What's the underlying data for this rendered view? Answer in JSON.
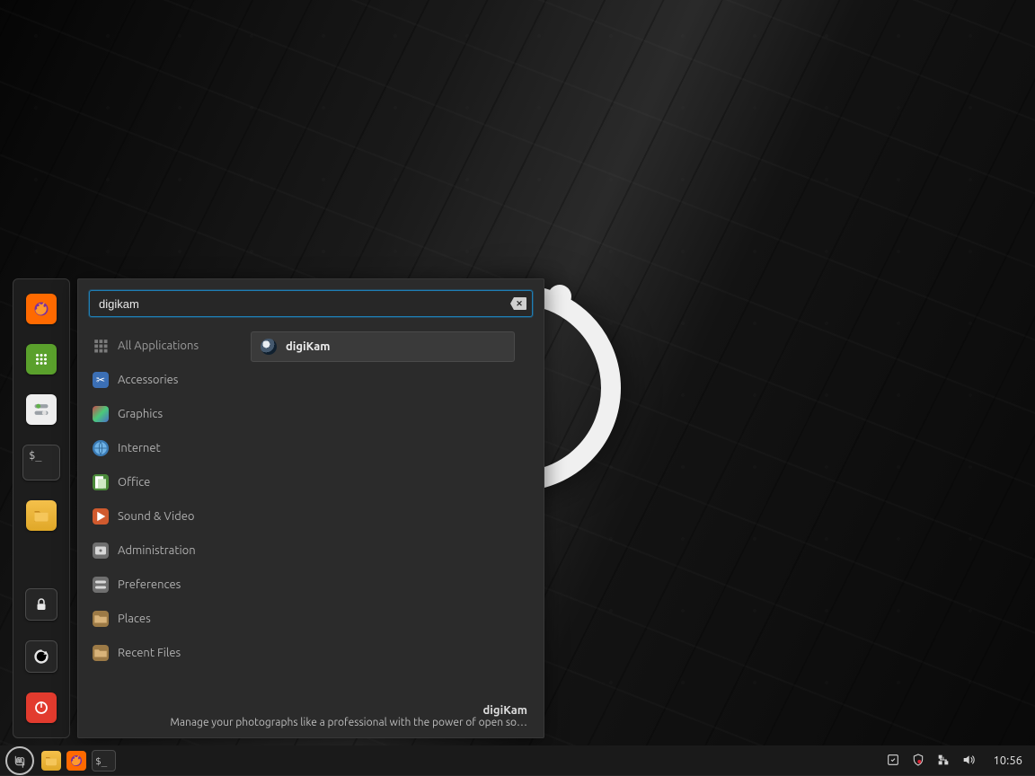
{
  "search": {
    "value": "digikam"
  },
  "categories": [
    {
      "label": "All Applications",
      "icon": "grid"
    },
    {
      "label": "Accessories",
      "icon": "scissors"
    },
    {
      "label": "Graphics",
      "icon": "palette"
    },
    {
      "label": "Internet",
      "icon": "globe"
    },
    {
      "label": "Office",
      "icon": "office"
    },
    {
      "label": "Sound & Video",
      "icon": "play"
    },
    {
      "label": "Administration",
      "icon": "admin"
    },
    {
      "label": "Preferences",
      "icon": "prefs"
    },
    {
      "label": "Places",
      "icon": "folder"
    },
    {
      "label": "Recent Files",
      "icon": "folder"
    }
  ],
  "results": [
    {
      "label": "digiKam"
    }
  ],
  "footer": {
    "title": "digiKam",
    "desc": "Manage your photographs like a professional with the power of open so…"
  },
  "taskbar": {
    "clock": "10:56"
  }
}
